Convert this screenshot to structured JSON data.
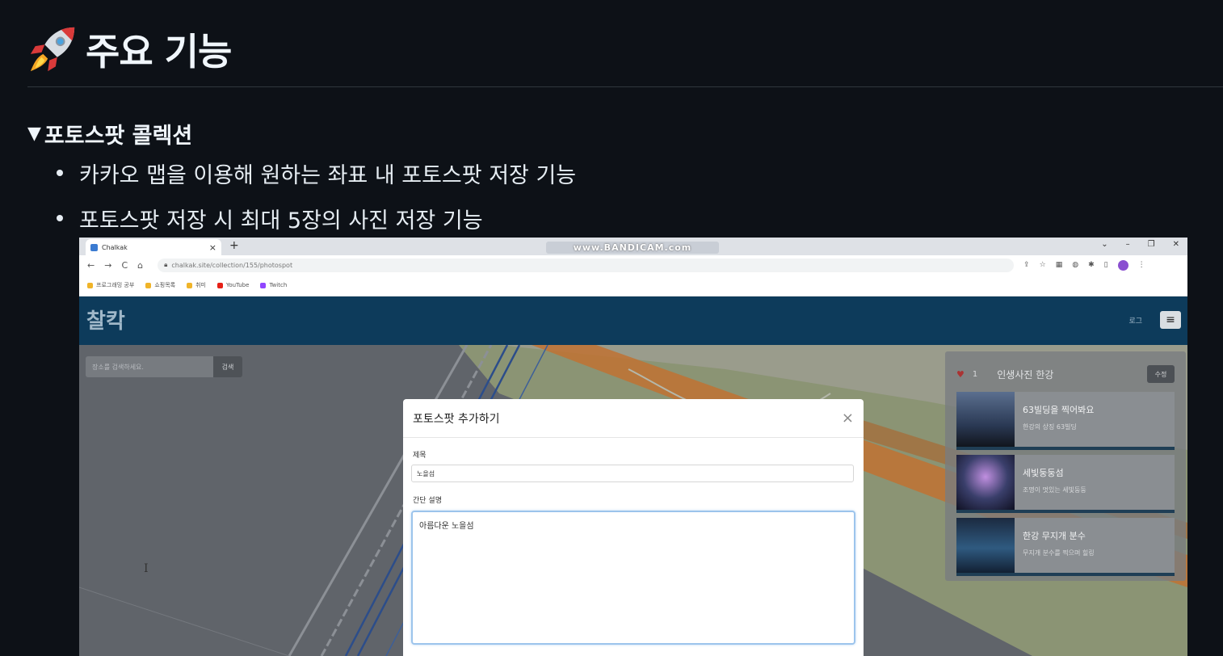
{
  "readme": {
    "heading": "주요 기능",
    "section_toggle": "▼",
    "section_title": "포토스팟 콜렉션",
    "bullets": [
      "카카오 맵을 이용해 원하는 좌표 내 포토스팟 저장 기능",
      "포토스팟 저장 시 최대 5장의 사진 저장 기능"
    ]
  },
  "browser": {
    "tab_title": "Chalkak",
    "tab_close": "×",
    "new_tab": "+",
    "watermark": "www.BANDICAM.com",
    "window_controls": [
      "⌄",
      "–",
      "❐",
      "✕"
    ],
    "nav": [
      "←",
      "→",
      "C",
      "⌂"
    ],
    "url": "chalkak.site/collection/155/photospot",
    "bookmarks": [
      {
        "label": "프로그래밍 공부",
        "color": "#f0b429"
      },
      {
        "label": "쇼핑목록",
        "color": "#f0b429"
      },
      {
        "label": "취미",
        "color": "#f0b429"
      },
      {
        "label": "YouTube",
        "color": "#e62117"
      },
      {
        "label": "Twitch",
        "color": "#9146ff"
      }
    ]
  },
  "app": {
    "brand": "찰칵",
    "login": "로그",
    "menu_icon": "≡"
  },
  "map": {
    "search_placeholder": "장소를 검색하세요.",
    "search_button": "검색"
  },
  "collection_panel": {
    "likes": "1",
    "title": "인생사진 한강",
    "edit_button": "수정",
    "cards": [
      {
        "title": "63빌딩을 찍어봐요",
        "desc": "한강의 상징 63빌딩",
        "thumb": "#2b3a55"
      },
      {
        "title": "세빛둥둥섬",
        "desc": "조명이 멋있는 세빛둥둥",
        "thumb": "#3a3f6b"
      },
      {
        "title": "한강 무지개 분수",
        "desc": "무지개 분수를 찍으며 힐링",
        "thumb": "#1e3550"
      }
    ]
  },
  "modal": {
    "title": "포토스팟 추가하기",
    "close": "×",
    "title_label": "제목",
    "title_value": "노을섬",
    "desc_label": "간단 설명",
    "desc_value": "아름다운 노을섬",
    "text_cursor": "I"
  }
}
